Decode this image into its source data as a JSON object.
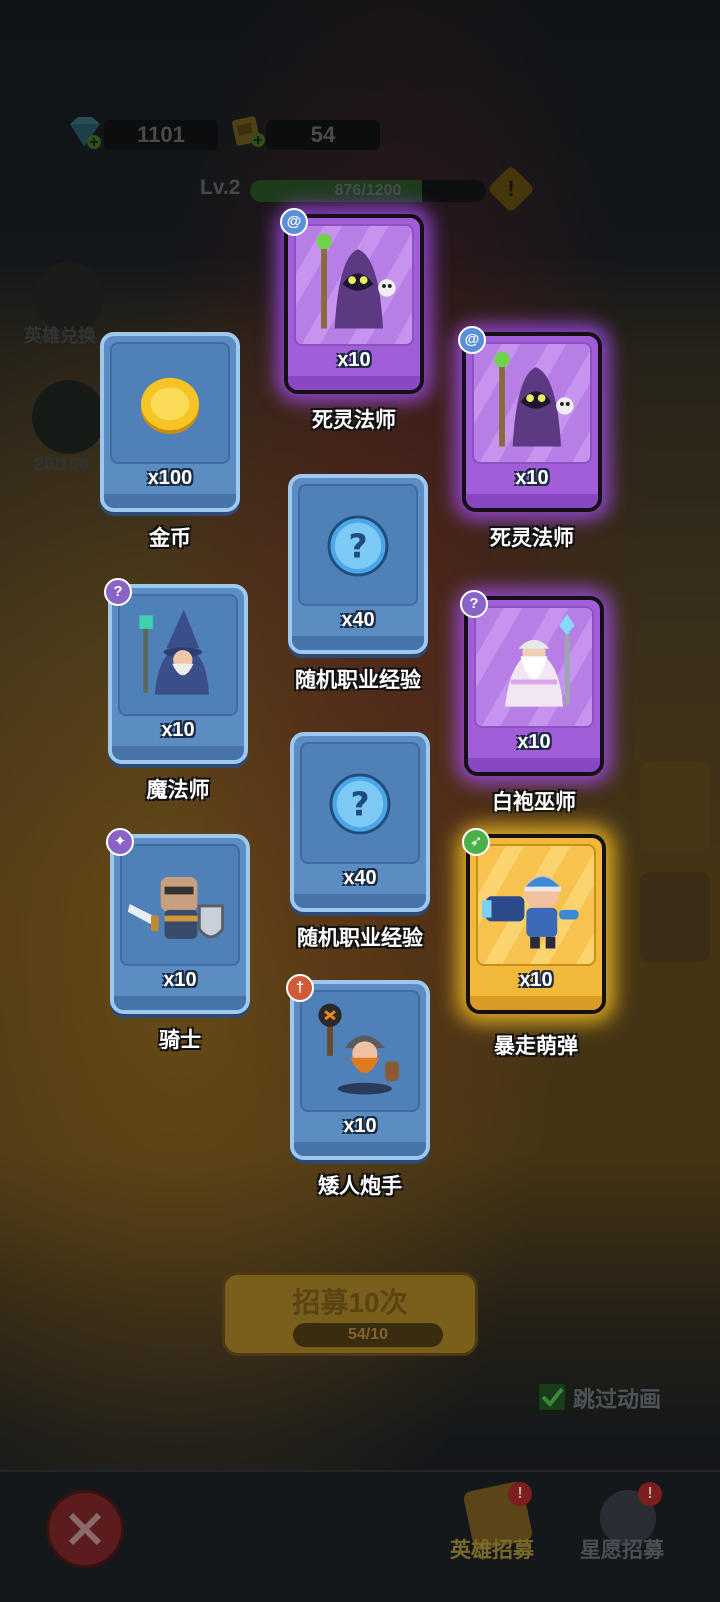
{
  "resources": {
    "gems": "1101",
    "tickets": "54"
  },
  "level": {
    "label": "Lv.2",
    "xp_text": "876/1200",
    "xp_progress": 0.73
  },
  "side": {
    "hero_exchange_label": "英雄兑换",
    "star_count": "20/100"
  },
  "cards": [
    {
      "name": "死灵法师",
      "count": "x10",
      "rarity": "purple",
      "class_icon": "swirl-icon",
      "art": "necromancer"
    },
    {
      "name": "金币",
      "count": "x100",
      "rarity": "blue",
      "class_icon": "",
      "art": "gold-coin"
    },
    {
      "name": "死灵法师",
      "count": "x10",
      "rarity": "purple",
      "class_icon": "swirl-icon",
      "art": "necromancer"
    },
    {
      "name": "随机职业经验",
      "count": "x40",
      "rarity": "blue",
      "class_icon": "",
      "art": "question-orb"
    },
    {
      "name": "魔法师",
      "count": "x10",
      "rarity": "blue",
      "class_icon": "staff-icon",
      "art": "wizard"
    },
    {
      "name": "白袍巫师",
      "count": "x10",
      "rarity": "purple",
      "class_icon": "staff-icon",
      "art": "white-wizard"
    },
    {
      "name": "随机职业经验",
      "count": "x40",
      "rarity": "blue",
      "class_icon": "",
      "art": "question-orb"
    },
    {
      "name": "骑士",
      "count": "x10",
      "rarity": "blue",
      "class_icon": "paw-icon",
      "art": "knight"
    },
    {
      "name": "暴走萌弹",
      "count": "x10",
      "rarity": "gold",
      "class_icon": "bow-icon",
      "art": "gunner"
    },
    {
      "name": "矮人炮手",
      "count": "x10",
      "rarity": "blue",
      "class_icon": "sword-icon",
      "art": "dwarf"
    }
  ],
  "recruit": {
    "title": "招募10次",
    "cost": "54/10"
  },
  "skip_animation": {
    "label": "跳过动画",
    "checked": true
  },
  "bottom_nav": {
    "hero_recruit": "英雄招募",
    "star_recruit": "星愿招募"
  },
  "colors": {
    "blue_card": "#5b8cc2",
    "purple_card": "#a25ed8",
    "gold_card": "#f2b83a"
  }
}
